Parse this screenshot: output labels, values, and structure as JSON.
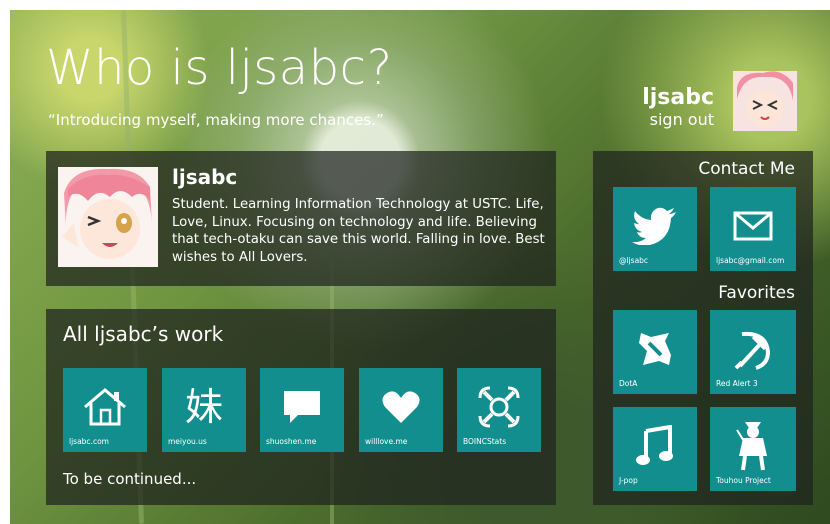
{
  "header": {
    "title": "Who is ljsabc?",
    "subtitle": "“Introducing myself, making more chances.”"
  },
  "user": {
    "name": "ljsabc",
    "signout": "sign out"
  },
  "profile": {
    "name": "ljsabc",
    "bio": "Student. Learning Information Technology at USTC. Life, Love, Linux. Focusing on technology and life. Believing that tech-otaku can save this world. Falling in love. Best wishes to All Lovers."
  },
  "work": {
    "title": "All ljsabc’s work",
    "tiles": [
      {
        "label": "ljsabc.com",
        "icon": "house-icon"
      },
      {
        "label": "meiyou.us",
        "icon": "mei-glyph",
        "glyph": "妹"
      },
      {
        "label": "shuoshen.me",
        "icon": "speech-bubble-icon"
      },
      {
        "label": "willlove.me",
        "icon": "heart-icon"
      },
      {
        "label": "BOINCStats",
        "icon": "boinc-icon"
      }
    ],
    "continued": "To be continued..."
  },
  "contact": {
    "title": "Contact Me",
    "tiles": [
      {
        "label": "@ljsabc",
        "icon": "twitter-bird-icon"
      },
      {
        "label": "ljsabc@gmail.com",
        "icon": "envelope-icon"
      }
    ]
  },
  "favorites": {
    "title": "Favorites",
    "tiles": [
      {
        "label": "DotA",
        "icon": "dota-icon"
      },
      {
        "label": "Red Alert 3",
        "icon": "hammer-sickle-icon"
      },
      {
        "label": "J-pop",
        "icon": "music-note-icon"
      },
      {
        "label": "Touhou Project",
        "icon": "touhou-character-icon"
      }
    ]
  },
  "colors": {
    "tile": "#138e8e",
    "panel": "rgba(30,34,30,0.72)"
  }
}
